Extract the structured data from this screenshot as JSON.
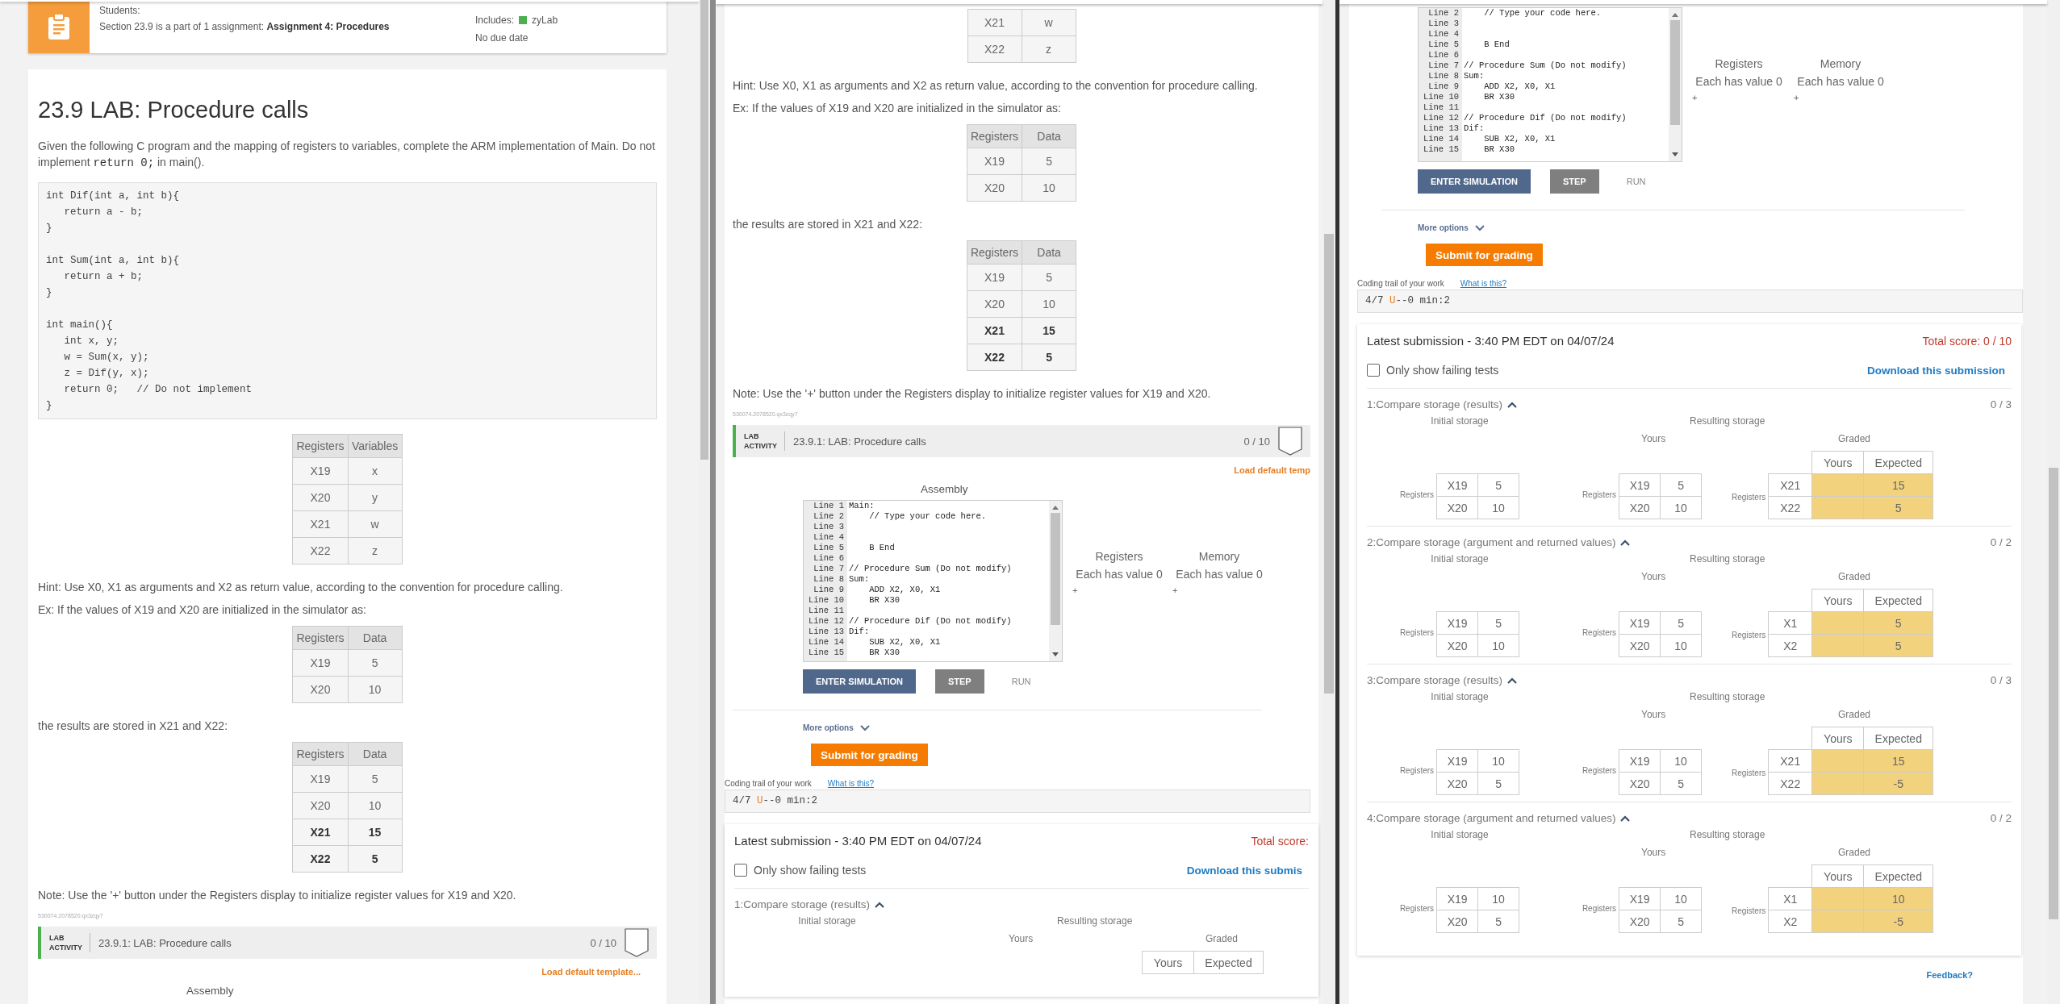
{
  "panes": [
    {
      "assignment": {
        "students": "Students:",
        "section": "Section 23.9 is a part of 1 assignment: **Assignment 4: Procedures**",
        "includes": "Includes:",
        "tag": "zyLab",
        "due": "No due date"
      },
      "blocks": [
        {
          "kind": "title",
          "text": "23.9 LAB: Procedure calls"
        },
        {
          "kind": "paragraph",
          "parts": [
            {
              "kind": "plain",
              "text": "Given the following C program and the mapping of registers to variables, complete the ARM implementation of Main. Do not implement "
            },
            {
              "kind": "code",
              "text": "return 0;"
            },
            {
              "kind": "plain",
              "text": " in main()."
            }
          ]
        },
        {
          "kind": "code",
          "groups": [
            [
              "int Dif(int a, int b){",
              "   return a - b;",
              "}"
            ],
            [
              "int Sum(int a, int b){",
              "   return a + b;",
              "}"
            ],
            [
              "int main(){",
              "   int x, y;",
              "   w = Sum(x, y);",
              "   z = Dif(y, x);",
              "   return 0;   // Do not implement",
              "}"
            ]
          ]
        },
        {
          "kind": "table",
          "columns": [
            "Registers",
            "Variables"
          ],
          "rows": [
            {
              "cells": [
                "X19",
                "x"
              ],
              "bold": false
            },
            {
              "cells": [
                "X20",
                "y"
              ],
              "bold": false
            },
            {
              "cells": [
                "X21",
                "w"
              ],
              "bold": false
            },
            {
              "cells": [
                "X22",
                "z"
              ],
              "bold": false
            }
          ]
        },
        {
          "kind": "paragraph",
          "parts": [
            {
              "kind": "plain",
              "text": "Hint: Use X0, X1 as arguments and X2 as return value, according to the convention for procedure calling."
            }
          ]
        },
        {
          "kind": "paragraph",
          "parts": [
            {
              "kind": "plain",
              "text": "Ex: If the values of X19 and X20 are initialized in the simulator as:"
            }
          ]
        },
        {
          "kind": "table",
          "columns": [
            "Registers",
            "Data"
          ],
          "rows": [
            {
              "cells": [
                "X19",
                "5"
              ],
              "bold": false
            },
            {
              "cells": [
                "X20",
                "10"
              ],
              "bold": false
            }
          ]
        },
        {
          "kind": "paragraph",
          "parts": [
            {
              "kind": "plain",
              "text": "the results are stored in X21 and X22:"
            }
          ]
        },
        {
          "kind": "table",
          "columns": [
            "Registers",
            "Data"
          ],
          "rows": [
            {
              "cells": [
                "X19",
                "5"
              ],
              "bold": false
            },
            {
              "cells": [
                "X20",
                "10"
              ],
              "bold": false
            },
            {
              "cells": [
                "X21",
                "15"
              ],
              "bold": true
            },
            {
              "cells": [
                "X22",
                "5"
              ],
              "bold": true
            }
          ]
        },
        {
          "kind": "paragraph",
          "parts": [
            {
              "kind": "plain",
              "text": "Note: Use the '+' button under the Registers display to initialize register values for X19 and X20."
            }
          ]
        },
        {
          "kind": "ref",
          "text": "530074.2078520.qx3zqy7"
        },
        {
          "kind": "lab",
          "label": "LAB ACTIVITY",
          "title": "23.9.1: LAB: Procedure calls",
          "score": "0 / 10"
        },
        {
          "kind": "load",
          "text": "Load default template..."
        },
        {
          "kind": "heading",
          "text": "Assembly"
        }
      ]
    },
    {
      "blocks": [
        {
          "kind": "table",
          "rows": [
            {
              "cells": [
                "X21",
                "w"
              ],
              "bold": false
            },
            {
              "cells": [
                "X22",
                "z"
              ],
              "bold": false
            }
          ]
        },
        {
          "kind": "paragraph",
          "parts": [
            {
              "kind": "plain",
              "text": "Hint: Use X0, X1 as arguments and X2 as return value, according to the convention for procedure calling."
            }
          ]
        },
        {
          "kind": "paragraph",
          "parts": [
            {
              "kind": "plain",
              "text": "Ex: If the values of X19 and X20 are initialized in the simulator as:"
            }
          ]
        },
        {
          "kind": "table",
          "columns": [
            "Registers",
            "Data"
          ],
          "rows": [
            {
              "cells": [
                "X19",
                "5"
              ],
              "bold": false
            },
            {
              "cells": [
                "X20",
                "10"
              ],
              "bold": false
            }
          ]
        },
        {
          "kind": "paragraph",
          "parts": [
            {
              "kind": "plain",
              "text": "the results are stored in X21 and X22:"
            }
          ]
        },
        {
          "kind": "table",
          "columns": [
            "Registers",
            "Data"
          ],
          "rows": [
            {
              "cells": [
                "X19",
                "5"
              ],
              "bold": false
            },
            {
              "cells": [
                "X20",
                "10"
              ],
              "bold": false
            },
            {
              "cells": [
                "X21",
                "15"
              ],
              "bold": true
            },
            {
              "cells": [
                "X22",
                "5"
              ],
              "bold": true
            }
          ]
        },
        {
          "kind": "paragraph",
          "parts": [
            {
              "kind": "plain",
              "text": "Note: Use the '+' button under the Registers display to initialize register values for X19 and X20."
            }
          ]
        },
        {
          "kind": "ref",
          "text": "530074.2078520.qx3zqy7"
        },
        {
          "kind": "lab",
          "label": "LAB ACTIVITY",
          "title": "23.9.1: LAB: Procedure calls",
          "score": "0 / 10"
        },
        {
          "kind": "load",
          "text": "Load default temp"
        },
        {
          "kind": "heading",
          "text": "Assembly"
        },
        {
          "kind": "editor",
          "lines": [
            {
              "number": "Line 1",
              "code": "Main:"
            },
            {
              "number": "Line 2",
              "code": "    // Type your code here."
            },
            {
              "number": "Line 3"
            },
            {
              "number": "Line 4"
            },
            {
              "number": "Line 5",
              "code": "    B End"
            },
            {
              "number": "Line 6"
            },
            {
              "number": "Line 7",
              "code": "// Procedure Sum (Do not modify)"
            },
            {
              "number": "Line 8",
              "code": "Sum:"
            },
            {
              "number": "Line 9",
              "code": "    ADD X2, X0, X1"
            },
            {
              "number": "Line 10",
              "code": "    BR X30"
            },
            {
              "number": "Line 11"
            },
            {
              "number": "Line 12",
              "code": "// Procedure Dif (Do not modify)"
            },
            {
              "number": "Line 13",
              "code": "Dif:"
            },
            {
              "number": "Line 14",
              "code": "    SUB X2, X0, X1"
            },
            {
              "number": "Line 15",
              "code": "    BR X30"
            }
          ],
          "panels": [
            {
              "title": "Registers",
              "status": "Each has value 0",
              "add": "+"
            },
            {
              "title": "Memory",
              "status": "Each has value 0",
              "add": "+"
            }
          ]
        },
        {
          "kind": "controls",
          "buttons": [
            {
              "label": "ENTER SIMULATION",
              "kind": "primary"
            },
            {
              "label": "STEP",
              "kind": "secondary"
            },
            {
              "label": "RUN",
              "kind": "text"
            }
          ]
        },
        {
          "kind": "more",
          "text": "More options"
        },
        {
          "kind": "submit",
          "text": "Submit for grading"
        },
        {
          "kind": "trail",
          "label": "Coding trail of your work",
          "link": "What is this?",
          "parts": [
            {
              "kind": "plain",
              "text": "4/7 "
            },
            {
              "kind": "mark",
              "text": "U"
            },
            {
              "kind": "plain",
              "text": "--0 min:2"
            }
          ]
        },
        {
          "kind": "submission",
          "title": "Latest submission - 3:40 PM EDT on 04/07/24",
          "score": "Total score:",
          "filter": {
            "label": "Only show failing tests",
            "checked": false
          },
          "download": "Download this submis",
          "tests": [
            {
              "name": "1:Compare storage (results)",
              "expanded": true,
              "initial": {
                "label": "Initial storage"
              },
              "result_label": "Resulting storage",
              "yours": {
                "label": "Yours"
              },
              "graded": {
                "label": "Graded",
                "columns": [
                  "Yours",
                  "Expected"
                ]
              }
            }
          ]
        }
      ]
    },
    {
      "blocks": [
        {
          "kind": "editor",
          "lines": [
            {
              "number": "Line 2",
              "code": "    // Type your code here."
            },
            {
              "number": "Line 3"
            },
            {
              "number": "Line 4"
            },
            {
              "number": "Line 5",
              "code": "    B End"
            },
            {
              "number": "Line 6"
            },
            {
              "number": "Line 7",
              "code": "// Procedure Sum (Do not modify)"
            },
            {
              "number": "Line 8",
              "code": "Sum:"
            },
            {
              "number": "Line 9",
              "code": "    ADD X2, X0, X1"
            },
            {
              "number": "Line 10",
              "code": "    BR X30"
            },
            {
              "number": "Line 11"
            },
            {
              "number": "Line 12",
              "code": "// Procedure Dif (Do not modify)"
            },
            {
              "number": "Line 13",
              "code": "Dif:"
            },
            {
              "number": "Line 14",
              "code": "    SUB X2, X0, X1"
            },
            {
              "number": "Line 15",
              "code": "    BR X30"
            }
          ],
          "panels": [
            {
              "title": "Registers",
              "status": "Each has value 0",
              "add": "+"
            },
            {
              "title": "Memory",
              "status": "Each has value 0",
              "add": "+"
            }
          ]
        },
        {
          "kind": "controls",
          "buttons": [
            {
              "label": "ENTER SIMULATION",
              "kind": "primary"
            },
            {
              "label": "STEP",
              "kind": "secondary"
            },
            {
              "label": "RUN",
              "kind": "text"
            }
          ]
        },
        {
          "kind": "more",
          "text": "More options"
        },
        {
          "kind": "submit",
          "text": "Submit for grading"
        },
        {
          "kind": "trail",
          "label": "Coding trail of your work",
          "link": "What is this?",
          "parts": [
            {
              "kind": "plain",
              "text": "4/7 "
            },
            {
              "kind": "mark",
              "text": "U"
            },
            {
              "kind": "plain",
              "text": "--0 min:2"
            }
          ]
        },
        {
          "kind": "submission",
          "title": "Latest submission - 3:40 PM EDT on 04/07/24",
          "score": "Total score: 0 / 10",
          "filter": {
            "label": "Only show failing tests",
            "checked": false
          },
          "download": "Download this submission",
          "tests": [
            {
              "name": "1:Compare storage (results)",
              "expanded": true,
              "score": "0 / 3",
              "initial": {
                "label": "Initial storage",
                "register_label": "Registers",
                "rows": [
                  [
                    "X19",
                    "5"
                  ],
                  [
                    "X20",
                    "10"
                  ]
                ]
              },
              "result_label": "Resulting storage",
              "yours": {
                "label": "Yours",
                "register_label": "Registers",
                "rows": [
                  [
                    "X19",
                    "5"
                  ],
                  [
                    "X20",
                    "10"
                  ]
                ]
              },
              "graded": {
                "label": "Graded",
                "register_label": "Registers",
                "columns": [
                  "Yours",
                  "Expected"
                ],
                "rows": [
                  {
                    "register": "X21",
                    "expected": "15",
                    "failed": true
                  },
                  {
                    "register": "X22",
                    "expected": "5",
                    "failed": true
                  }
                ]
              }
            },
            {
              "name": "2:Compare storage (argument and returned values)",
              "expanded": true,
              "score": "0 / 2",
              "initial": {
                "label": "Initial storage",
                "register_label": "Registers",
                "rows": [
                  [
                    "X19",
                    "5"
                  ],
                  [
                    "X20",
                    "10"
                  ]
                ]
              },
              "result_label": "Resulting storage",
              "yours": {
                "label": "Yours",
                "register_label": "Registers",
                "rows": [
                  [
                    "X19",
                    "5"
                  ],
                  [
                    "X20",
                    "10"
                  ]
                ]
              },
              "graded": {
                "label": "Graded",
                "register_label": "Registers",
                "columns": [
                  "Yours",
                  "Expected"
                ],
                "rows": [
                  {
                    "register": "X1",
                    "expected": "5",
                    "failed": true
                  },
                  {
                    "register": "X2",
                    "expected": "5",
                    "failed": true
                  }
                ]
              }
            },
            {
              "name": "3:Compare storage (results)",
              "expanded": true,
              "score": "0 / 3",
              "initial": {
                "label": "Initial storage",
                "register_label": "Registers",
                "rows": [
                  [
                    "X19",
                    "10"
                  ],
                  [
                    "X20",
                    "5"
                  ]
                ]
              },
              "result_label": "Resulting storage",
              "yours": {
                "label": "Yours",
                "register_label": "Registers",
                "rows": [
                  [
                    "X19",
                    "10"
                  ],
                  [
                    "X20",
                    "5"
                  ]
                ]
              },
              "graded": {
                "label": "Graded",
                "register_label": "Registers",
                "columns": [
                  "Yours",
                  "Expected"
                ],
                "rows": [
                  {
                    "register": "X21",
                    "expected": "15",
                    "failed": true
                  },
                  {
                    "register": "X22",
                    "expected": "-5",
                    "failed": true
                  }
                ]
              }
            },
            {
              "name": "4:Compare storage (argument and returned values)",
              "expanded": true,
              "score": "0 / 2",
              "initial": {
                "label": "Initial storage",
                "register_label": "Registers",
                "rows": [
                  [
                    "X19",
                    "10"
                  ],
                  [
                    "X20",
                    "5"
                  ]
                ]
              },
              "result_label": "Resulting storage",
              "yours": {
                "label": "Yours",
                "register_label": "Registers",
                "rows": [
                  [
                    "X19",
                    "10"
                  ],
                  [
                    "X20",
                    "5"
                  ]
                ]
              },
              "graded": {
                "label": "Graded",
                "register_label": "Registers",
                "columns": [
                  "Yours",
                  "Expected"
                ],
                "rows": [
                  {
                    "register": "X1",
                    "expected": "10",
                    "failed": true
                  },
                  {
                    "register": "X2",
                    "expected": "-5",
                    "failed": true
                  }
                ]
              }
            }
          ]
        },
        {
          "kind": "feedback",
          "text": "Feedback?"
        }
      ]
    }
  ]
}
